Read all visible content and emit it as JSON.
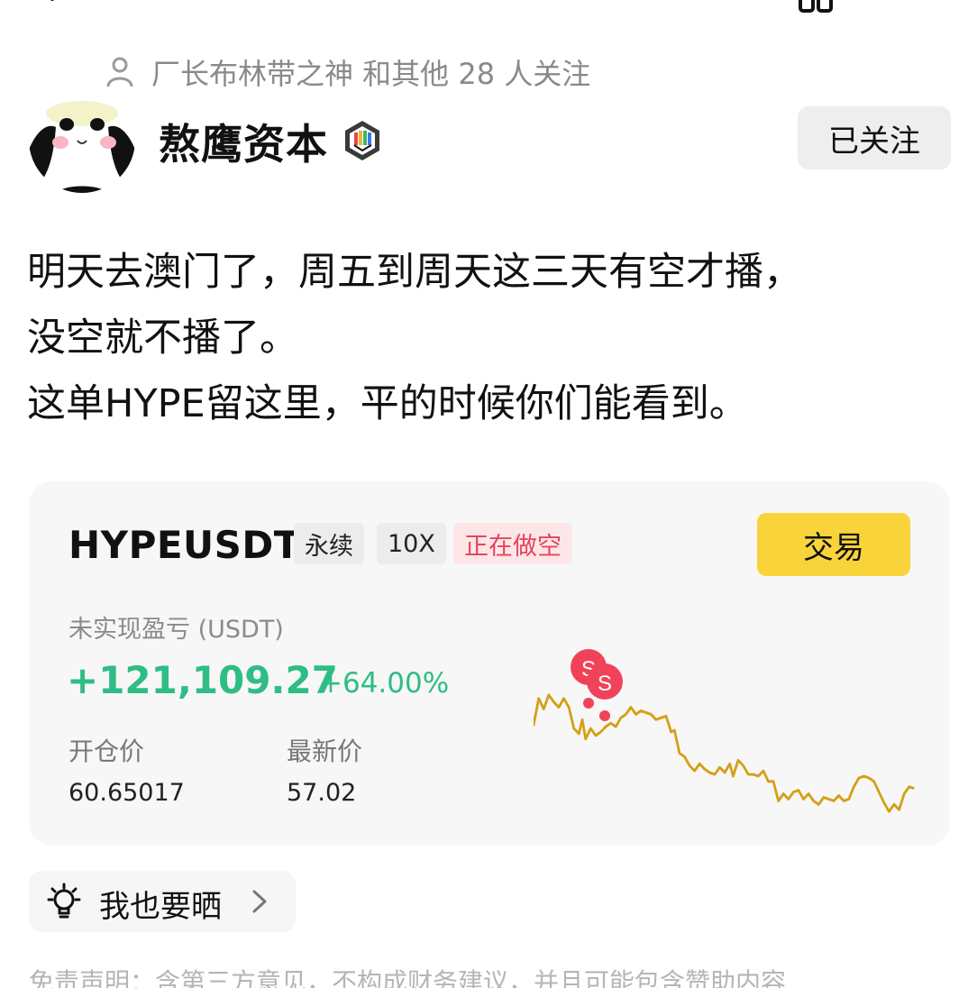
{
  "followers": {
    "text": "厂长布林带之神 和其他 28 人关注"
  },
  "author": {
    "name": "熬鹰资本",
    "follow_label": "已关注"
  },
  "post": {
    "lines": [
      "明天去澳门了，周五到周天这三天有空才播，",
      "没空就不播了。",
      "这单HYPE留这里，平的时候你们能看到。"
    ]
  },
  "position_card": {
    "symbol": "HYPEUSDT",
    "tags": [
      "永续",
      "10X",
      "正在做空"
    ],
    "trade_label": "交易",
    "pnl_label": "未实现盈亏 (USDT)",
    "pnl_value": "+121,109.27",
    "pnl_percent": "+64.00%",
    "entry_label": "开仓价",
    "entry_value": "60.65017",
    "last_label": "最新价",
    "last_value": "57.02",
    "marker_letter": "S",
    "colors": {
      "profit": "#2ebd85",
      "line": "#d4a017",
      "sell_marker": "#f0435a",
      "trade_button": "#f8d33a"
    }
  },
  "share": {
    "label": "我也要晒"
  },
  "disclaimer": "免责声明：含第三方意见，不构成财务建议，并且可能包含赞助内容",
  "icons": {
    "back": "back-arrow-icon",
    "more": "more-icon",
    "person": "person-icon",
    "badge": "verified-badge-icon",
    "bulb": "lightbulb-icon",
    "chevron": "chevron-right-icon"
  }
}
